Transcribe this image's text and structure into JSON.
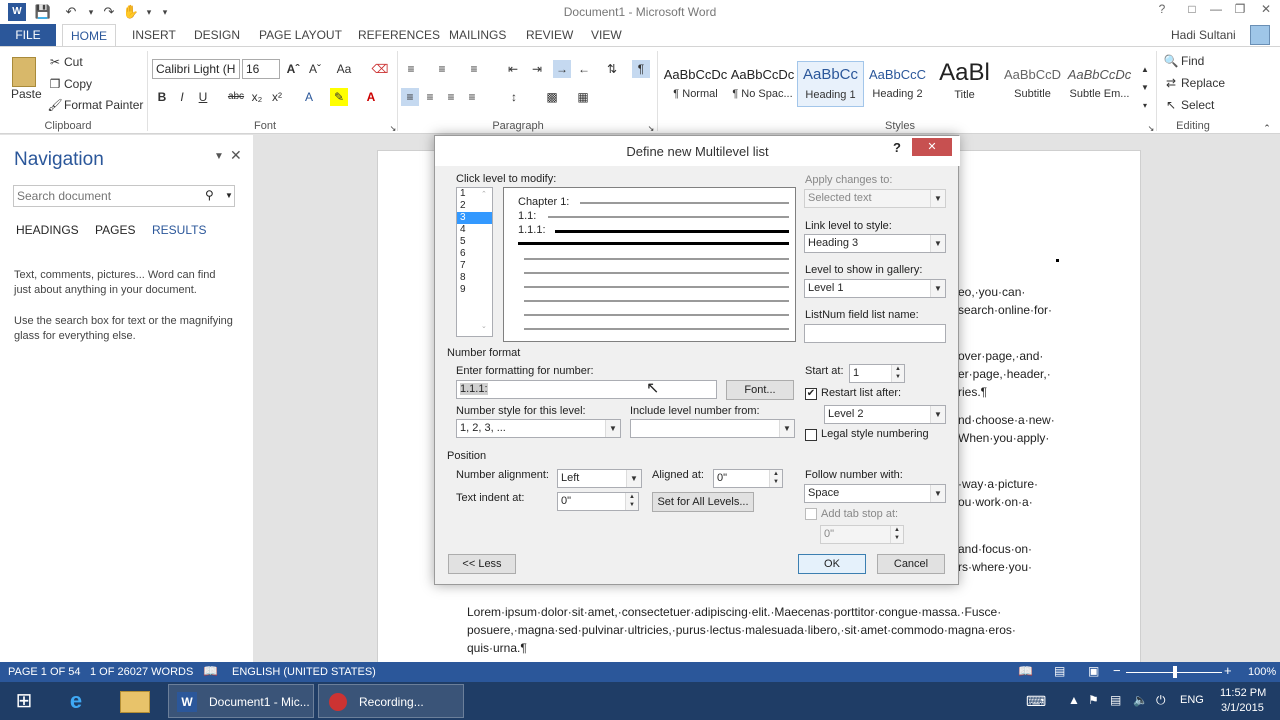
{
  "window": {
    "title": "Document1 - Microsoft Word",
    "user": "Hadi Sultani"
  },
  "tabs": [
    "FILE",
    "HOME",
    "INSERT",
    "DESIGN",
    "PAGE LAYOUT",
    "REFERENCES",
    "MAILINGS",
    "REVIEW",
    "VIEW"
  ],
  "ribbon": {
    "clipboard": {
      "paste": "Paste",
      "cut": "Cut",
      "copy": "Copy",
      "format_painter": "Format Painter",
      "label": "Clipboard"
    },
    "font": {
      "name": "Calibri Light (H",
      "size": "16",
      "label": "Font"
    },
    "paragraph": {
      "label": "Paragraph"
    },
    "styles": {
      "label": "Styles",
      "items": [
        {
          "preview": "AaBbCcDc",
          "name": "¶ Normal"
        },
        {
          "preview": "AaBbCcDc",
          "name": "¶ No Spac..."
        },
        {
          "preview": "AaBbCc",
          "name": "Heading 1"
        },
        {
          "preview": "AaBbCcC",
          "name": "Heading 2"
        },
        {
          "preview": "AaBl",
          "name": "Title"
        },
        {
          "preview": "AaBbCcD",
          "name": "Subtitle"
        },
        {
          "preview": "AaBbCcDc",
          "name": "Subtle Em..."
        }
      ]
    },
    "editing": {
      "find": "Find",
      "replace": "Replace",
      "select": "Select",
      "label": "Editing"
    }
  },
  "navigation": {
    "title": "Navigation",
    "search_placeholder": "Search document",
    "tabs": [
      "HEADINGS",
      "PAGES",
      "RESULTS"
    ],
    "help1": "Text, comments, pictures... Word can find",
    "help1b": "just about anything in your document.",
    "help2": "Use the search box for text or the magnifying",
    "help2b": "glass for everything else."
  },
  "document": {
    "fragments": [
      "eo,·you·can·",
      "search·online·for·",
      "over·page,·and·",
      "er·page,·header,·",
      "ries.¶",
      "nd·choose·a·new·",
      "When·you·apply·",
      "·way·a·picture·",
      "ou·work·on·a·",
      "and·focus·on·",
      "rs·where·you·"
    ],
    "para1": "Lorem·ipsum·dolor·sit·amet,·consectetuer·adipiscing·elit.·Maecenas·porttitor·congue·massa.·Fusce·",
    "para2": "posuere,·magna·sed·pulvinar·ultricies,·purus·lectus·malesuada·libero,·sit·amet·commodo·magna·eros·",
    "para3": "quis·urna.¶"
  },
  "dialog": {
    "title": "Define new Multilevel list",
    "click_level": "Click level to modify:",
    "levels": [
      "1",
      "2",
      "3",
      "4",
      "5",
      "6",
      "7",
      "8",
      "9"
    ],
    "selected_level": "3",
    "preview": {
      "l1": "Chapter 1:",
      "l2": "1.1:",
      "l3": "1.1.1:"
    },
    "apply_changes_label": "Apply changes to:",
    "apply_changes_value": "Selected text",
    "link_level_label": "Link level to style:",
    "link_level_value": "Heading 3",
    "gallery_label": "Level to show in gallery:",
    "gallery_value": "Level 1",
    "listnum_label": "ListNum field list name:",
    "listnum_value": "",
    "number_format_section": "Number format",
    "enter_format_label": "Enter formatting for number:",
    "enter_format_value": "1.1.1:",
    "font_button": "Font...",
    "number_style_label": "Number style for this level:",
    "number_style_value": "1, 2, 3, ...",
    "include_level_label": "Include level number from:",
    "include_level_value": "",
    "start_at_label": "Start at:",
    "start_at_value": "1",
    "restart_label": "Restart list after:",
    "restart_checked": true,
    "restart_value": "Level 2",
    "legal_label": "Legal style numbering",
    "position_section": "Position",
    "number_alignment_label": "Number alignment:",
    "number_alignment_value": "Left",
    "aligned_at_label": "Aligned at:",
    "aligned_at_value": "0\"",
    "text_indent_label": "Text indent at:",
    "text_indent_value": "0\"",
    "set_all_button": "Set for All Levels...",
    "follow_label": "Follow number with:",
    "follow_value": "Space",
    "tab_stop_label": "Add tab stop at:",
    "tab_stop_value": "0\"",
    "less_button": "<< Less",
    "ok_button": "OK",
    "cancel_button": "Cancel",
    "help": "?",
    "close": "✕"
  },
  "statusbar": {
    "page": "PAGE 1 OF 54",
    "words": "1 OF 26027 WORDS",
    "language": "ENGLISH (UNITED STATES)",
    "zoom": "100%"
  },
  "taskbar": {
    "word_task": "Document1 - Mic...",
    "recording_task": "Recording...",
    "lang": "ENG",
    "time": "11:52 PM",
    "date": "3/1/2015"
  }
}
